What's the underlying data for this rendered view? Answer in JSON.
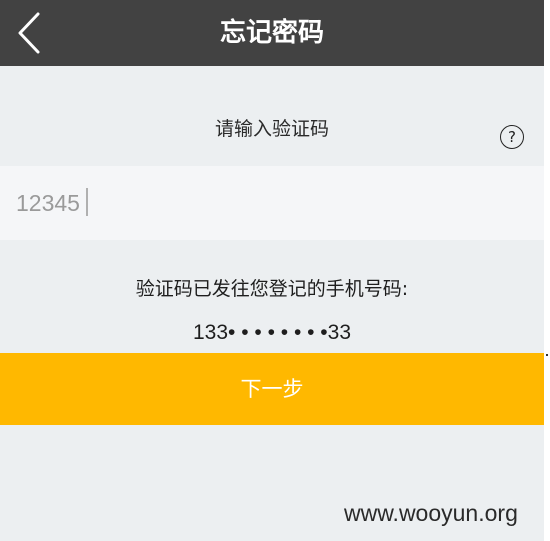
{
  "nav": {
    "title": "忘记密码",
    "back_icon": "chevron-left-icon"
  },
  "verification": {
    "prompt": "请输入验证码",
    "help_icon_label": "?",
    "code_value": "12345",
    "sent_label": "验证码已发往您登记的手机号码:",
    "phone_masked": "133• • • • • • • •33"
  },
  "actions": {
    "next_label": "下一步"
  },
  "watermark": {
    "text": "www.wooyun.org"
  },
  "colors": {
    "nav_bg": "#424242",
    "page_bg": "#eceff1",
    "field_bg": "#f5f6f8",
    "accent": "#ffb800"
  }
}
